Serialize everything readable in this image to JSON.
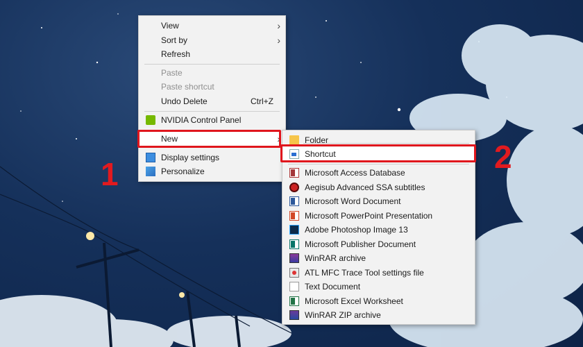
{
  "context_menu": {
    "items": [
      {
        "label": "View",
        "has_submenu": true
      },
      {
        "label": "Sort by",
        "has_submenu": true
      },
      {
        "label": "Refresh"
      },
      {
        "label": "Paste",
        "disabled": true
      },
      {
        "label": "Paste shortcut",
        "disabled": true
      },
      {
        "label": "Undo Delete",
        "shortcut": "Ctrl+Z"
      },
      {
        "label": "NVIDIA Control Panel",
        "icon": "nvidia-icon"
      },
      {
        "label": "New",
        "has_submenu": true,
        "highlighted": true
      },
      {
        "label": "Display settings",
        "icon": "display-settings-icon"
      },
      {
        "label": "Personalize",
        "icon": "personalize-icon"
      }
    ]
  },
  "new_submenu": {
    "items": [
      {
        "label": "Folder",
        "icon": "folder-icon"
      },
      {
        "label": "Shortcut",
        "icon": "shortcut-icon",
        "highlighted": true
      },
      {
        "label": "Microsoft Access Database",
        "icon": "access-icon"
      },
      {
        "label": "Aegisub Advanced SSA subtitles",
        "icon": "aegisub-icon"
      },
      {
        "label": "Microsoft Word Document",
        "icon": "word-icon"
      },
      {
        "label": "Microsoft PowerPoint Presentation",
        "icon": "powerpoint-icon"
      },
      {
        "label": "Adobe Photoshop Image 13",
        "icon": "photoshop-icon"
      },
      {
        "label": "Microsoft Publisher Document",
        "icon": "publisher-icon"
      },
      {
        "label": "WinRAR archive",
        "icon": "winrar-icon"
      },
      {
        "label": "ATL MFC Trace Tool settings file",
        "icon": "atl-trace-icon"
      },
      {
        "label": "Text Document",
        "icon": "text-document-icon"
      },
      {
        "label": "Microsoft Excel Worksheet",
        "icon": "excel-icon"
      },
      {
        "label": "WinRAR ZIP archive",
        "icon": "winrar-zip-icon"
      }
    ]
  },
  "step_markers": {
    "step1": "1",
    "step2": "2"
  },
  "colors": {
    "highlight": "#e0161d",
    "menu_bg": "#f2f2f2",
    "sky": "#15305a"
  }
}
